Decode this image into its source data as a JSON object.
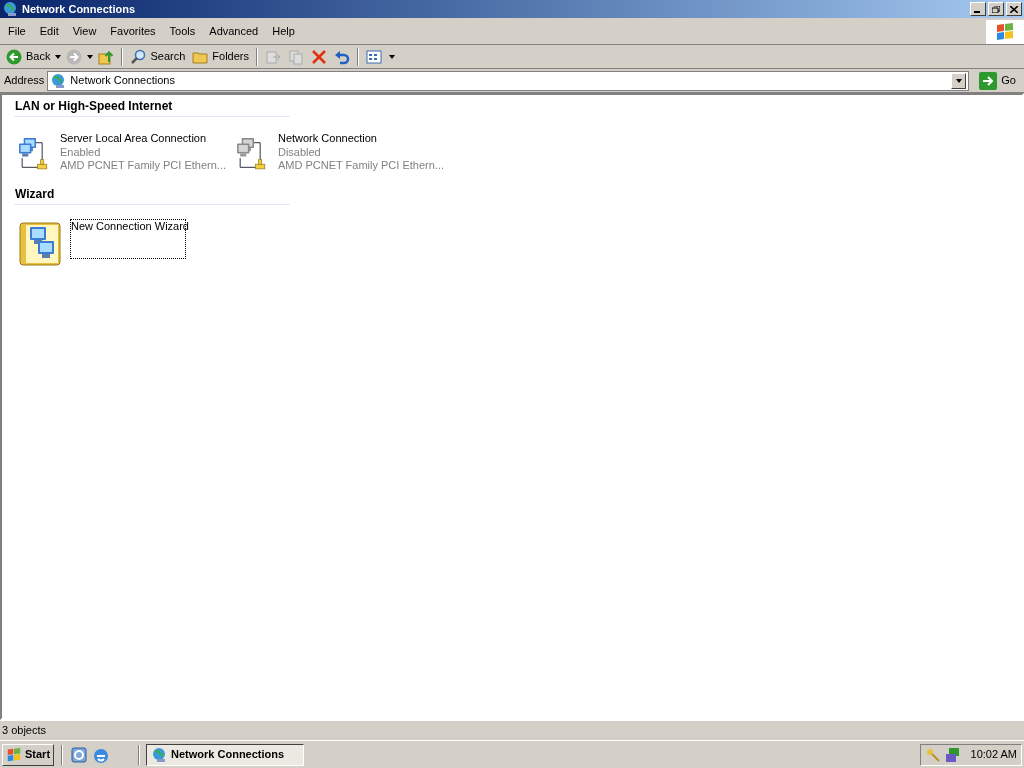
{
  "window": {
    "title": "Network Connections"
  },
  "menu": [
    "File",
    "Edit",
    "View",
    "Favorites",
    "Tools",
    "Advanced",
    "Help"
  ],
  "toolbar": [
    {
      "kind": "back",
      "label": "Back"
    },
    {
      "kind": "forward"
    },
    {
      "kind": "up"
    },
    {
      "kind": "search",
      "label": "Search"
    },
    {
      "kind": "folders",
      "label": "Folders"
    },
    {
      "kind": "move"
    },
    {
      "kind": "copy"
    },
    {
      "kind": "delete"
    },
    {
      "kind": "undo"
    },
    {
      "kind": "views"
    }
  ],
  "address": {
    "label": "Address",
    "value": "Network Connections",
    "go": "Go"
  },
  "groups": [
    {
      "title": "LAN or High-Speed Internet",
      "items": [
        {
          "kind": "connection",
          "name": "Server Local Area Connection",
          "status": "Enabled",
          "enabled": true,
          "device": "AMD PCNET Family PCI Ethern...",
          "selected": false
        },
        {
          "kind": "connection",
          "name": "Network Connection",
          "status": "Disabled",
          "enabled": false,
          "device": "AMD PCNET Family PCI Ethern...",
          "selected": false
        }
      ]
    },
    {
      "title": "Wizard",
      "items": [
        {
          "kind": "wizard",
          "name": "New Connection Wizard",
          "selected": true
        }
      ]
    }
  ],
  "status_bar": "3 objects",
  "taskbar": {
    "start": "Start",
    "tasks": [
      {
        "label": "Network Connections",
        "selected": true
      }
    ],
    "clock": "10:02 AM"
  }
}
